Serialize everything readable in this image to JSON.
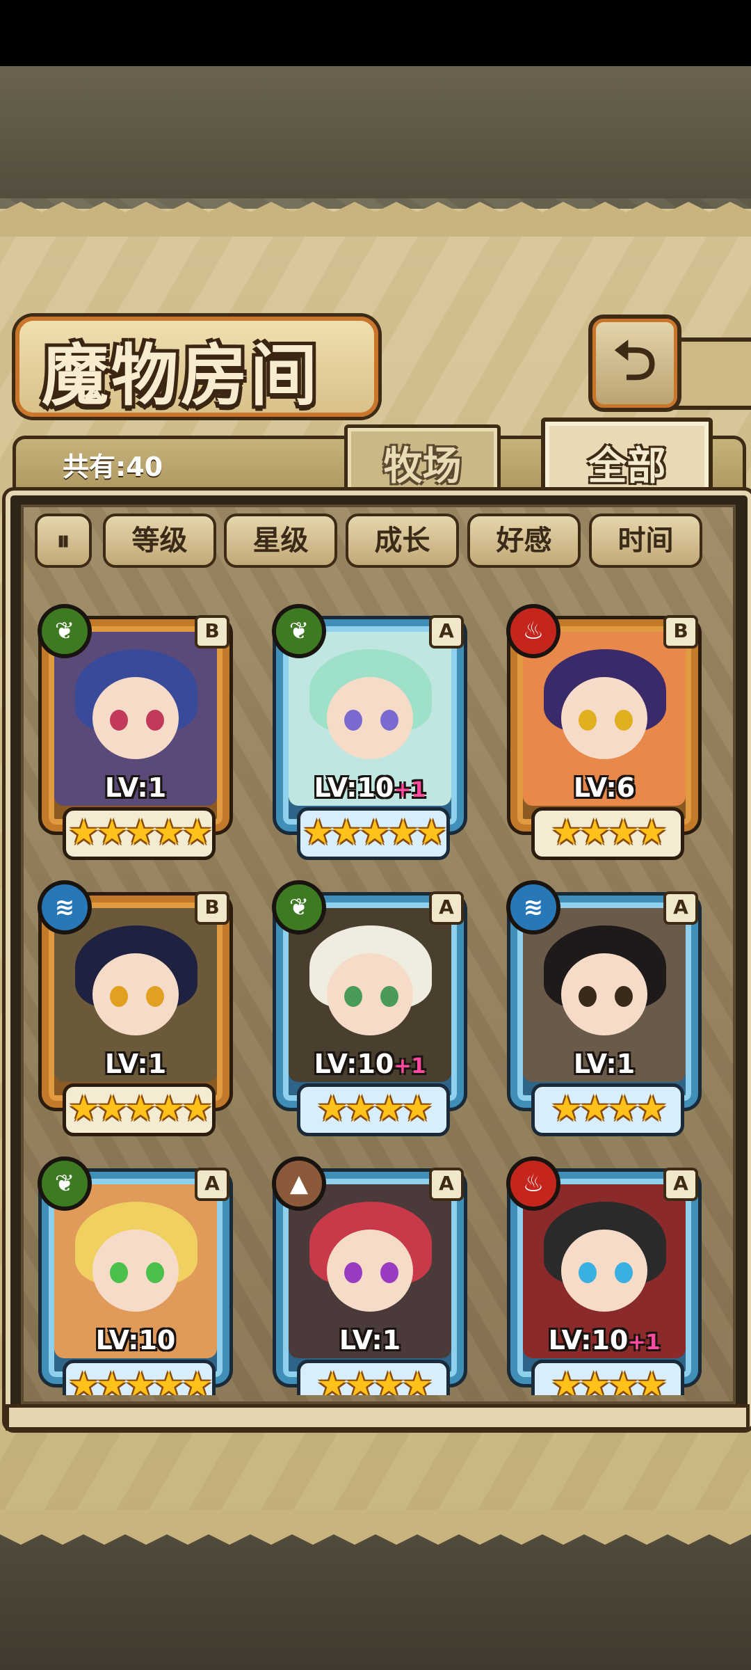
{
  "title": "魔物房间",
  "back_icon": "return-arrow-icon",
  "count_label": "共有:40",
  "tabs": [
    {
      "label": "牧场",
      "active": false
    },
    {
      "label": "全部",
      "active": true
    }
  ],
  "sort_buttons": [
    "等级",
    "星级",
    "成长",
    "好感",
    "时间"
  ],
  "pause_glyph": "⏸",
  "colors": {
    "gold_frame": "#c07a2a",
    "blue_frame": "#3f8fb8",
    "star": "#ffc21a",
    "plus": "#ff4aa0"
  },
  "monsters": [
    {
      "element": "leaf",
      "rank": "B",
      "frame": "gold",
      "lv": "LV:1",
      "plus": "",
      "stars": "★★★★★",
      "star_count": 5,
      "hair": "#3a4a9a",
      "eye": "#c23a5a",
      "bg": "#5a4a7a"
    },
    {
      "element": "leaf",
      "rank": "A",
      "frame": "blue",
      "lv": "LV:10",
      "plus": "+1",
      "stars": "★★★★★",
      "star_count": 5,
      "hair": "#9fe0c8",
      "eye": "#7a6ad0",
      "bg": "#bfe6e0"
    },
    {
      "element": "fire",
      "rank": "B",
      "frame": "gold",
      "lv": "LV:6",
      "plus": "",
      "stars": "★★★★",
      "star_count": 4,
      "hair": "#3a2a6a",
      "eye": "#e0b020",
      "bg": "#e8884a"
    },
    {
      "element": "water",
      "rank": "B",
      "frame": "gold",
      "lv": "LV:1",
      "plus": "",
      "stars": "★★★★★",
      "star_count": 5,
      "hair": "#1e2240",
      "eye": "#e0a020",
      "bg": "#6a5a3a"
    },
    {
      "element": "leaf",
      "rank": "A",
      "frame": "blue",
      "lv": "LV:10",
      "plus": "+1",
      "stars": "★★★★",
      "star_count": 4,
      "hair": "#f0ece0",
      "eye": "#4a9a5a",
      "bg": "#4a3e2e"
    },
    {
      "element": "water",
      "rank": "A",
      "frame": "blue",
      "lv": "LV:1",
      "plus": "",
      "stars": "★★★★",
      "star_count": 4,
      "hair": "#1e1a1a",
      "eye": "#3a2a1a",
      "bg": "#6a5a4a"
    },
    {
      "element": "leaf",
      "rank": "A",
      "frame": "blue",
      "lv": "LV:10",
      "plus": "",
      "stars": "★★★★★",
      "star_count": 5,
      "hair": "#f0d060",
      "eye": "#4ac04a",
      "bg": "#e09a5a"
    },
    {
      "element": "earth",
      "rank": "A",
      "frame": "blue",
      "lv": "LV:1",
      "plus": "",
      "stars": "★★★★",
      "star_count": 4,
      "hair": "#c83a4a",
      "eye": "#9a3ac0",
      "bg": "#4a3a3a"
    },
    {
      "element": "fire",
      "rank": "A",
      "frame": "blue",
      "lv": "LV:10",
      "plus": "+1",
      "stars": "★★★★",
      "star_count": 4,
      "hair": "#2a2a2a",
      "eye": "#3ab0e0",
      "bg": "#8a2a2a"
    }
  ]
}
